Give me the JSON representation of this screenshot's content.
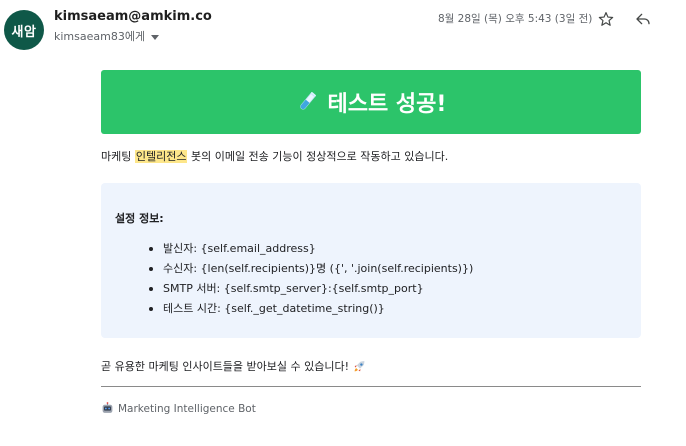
{
  "header": {
    "avatar_text": "새암",
    "sender": "kimsaeam@amkim.co",
    "recipient": "kimsaeam83에게",
    "timestamp": "8월 28일 (목) 오후 5:43 (3일 전)"
  },
  "icons": {
    "star": "star-icon",
    "reply": "reply-icon",
    "caret": "chevron-down-icon",
    "flask": "test-tube-icon",
    "rocket": "rocket-icon",
    "robot": "robot-icon"
  },
  "colors": {
    "banner": "#2cc46a",
    "avatar": "#0f5848",
    "highlight": "#fde68a",
    "info_box": "#eef4fd"
  },
  "email": {
    "banner_title": "테스트 성공!",
    "intro_prefix": "마케팅 ",
    "intro_highlight": "인텔리전스",
    "intro_suffix": " 봇의 이메일 전송 기능이 정상적으로 작동하고 있습니다.",
    "info_title": "설정 정보:",
    "info_items": [
      "발신자: {self.email_address}",
      "수신자: {len(self.recipients)}명 ({', '.join(self.recipients)})",
      "SMTP 서버: {self.smtp_server}:{self.smtp_port}",
      "테스트 시간: {self._get_datetime_string()}"
    ],
    "closing": "곧 유용한 마케팅 인사이트들을 받아보실 수 있습니다!",
    "footer": "Marketing Intelligence Bot"
  }
}
